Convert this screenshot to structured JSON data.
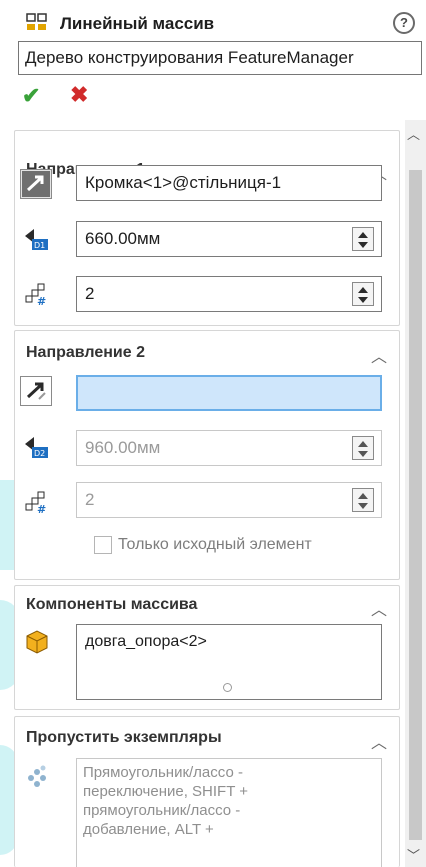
{
  "header": {
    "title": "Линейный массив",
    "tooltip": "Дерево конструирования FeatureManager",
    "help_icon": "question-circle-icon"
  },
  "actions": {
    "ok_icon": "check-icon",
    "cancel_icon": "close-icon",
    "ok_color": "#3aa23a",
    "cancel_color": "#d12b2b"
  },
  "direction1": {
    "title": "Направление 1",
    "edge_value": "Кромка<1>@стільниця-1",
    "distance_value": "660.00мм",
    "count_value": "2"
  },
  "direction2": {
    "title": "Направление 2",
    "edge_value": "",
    "distance_value": "960.00мм",
    "count_value": "2",
    "seed_only_label": "Только исходный элемент"
  },
  "components": {
    "title": "Компоненты массива",
    "items": [
      "довга_опора<2>"
    ]
  },
  "skip": {
    "title": "Пропустить экземпляры",
    "hint": "Прямоугольник/лассо - переключение, SHIFT + прямоугольник/лассо - добавление, ALT +"
  }
}
